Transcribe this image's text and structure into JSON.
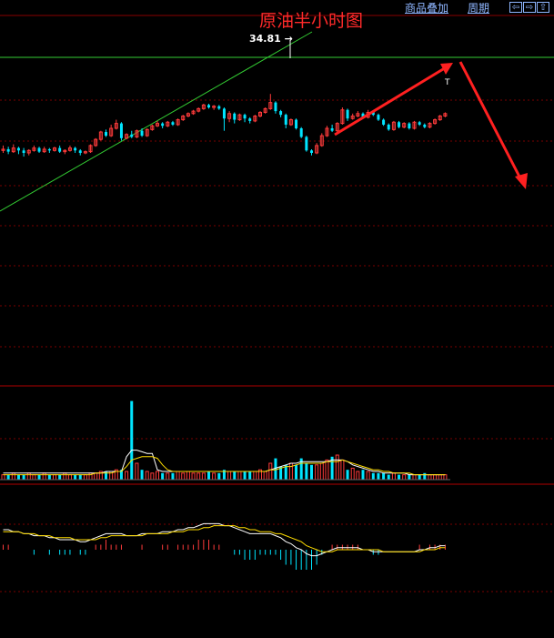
{
  "title": "原油半小时图",
  "toolbar": {
    "overlay_label": "商品叠加",
    "period_label": "周期",
    "nav_buttons": [
      {
        "icon": "arrow-left-icon",
        "glyph": "⇦"
      },
      {
        "icon": "arrow-right-icon",
        "glyph": "⇨"
      },
      {
        "icon": "arrow-up-icon",
        "glyph": "⇧"
      }
    ]
  },
  "colors": {
    "background": "#000000",
    "up_candle": "#ff3b3b",
    "down_candle": "#00e5ff",
    "grid": "#7a0000",
    "trendline": "#33cc33",
    "annotation_arrow": "#ff2020",
    "ma_white": "#ffffff",
    "ma_yellow": "#ffdd00",
    "title": "#ff2a2a",
    "toolbar_link": "#8fb6ff"
  },
  "chart_data": {
    "type": "candlestick",
    "title": "原油半小时图",
    "high_label": "34.81",
    "marker_label": "T",
    "price_scale": {
      "min": 0,
      "max": 100
    },
    "candles": [
      {
        "o": 62,
        "c": 63,
        "h": 66,
        "l": 60
      },
      {
        "o": 63,
        "c": 61,
        "h": 65,
        "l": 59
      },
      {
        "o": 61,
        "c": 64,
        "h": 67,
        "l": 60
      },
      {
        "o": 64,
        "c": 62,
        "h": 65,
        "l": 59
      },
      {
        "o": 62,
        "c": 60,
        "h": 64,
        "l": 57
      },
      {
        "o": 60,
        "c": 62,
        "h": 63,
        "l": 58
      },
      {
        "o": 62,
        "c": 64,
        "h": 66,
        "l": 61
      },
      {
        "o": 64,
        "c": 61,
        "h": 65,
        "l": 60
      },
      {
        "o": 61,
        "c": 63,
        "h": 65,
        "l": 60
      },
      {
        "o": 63,
        "c": 62,
        "h": 64,
        "l": 60
      },
      {
        "o": 62,
        "c": 64,
        "h": 65,
        "l": 61
      },
      {
        "o": 64,
        "c": 61,
        "h": 66,
        "l": 60
      },
      {
        "o": 61,
        "c": 62,
        "h": 63,
        "l": 59
      },
      {
        "o": 62,
        "c": 64,
        "h": 66,
        "l": 61
      },
      {
        "o": 64,
        "c": 62,
        "h": 65,
        "l": 60
      },
      {
        "o": 62,
        "c": 60,
        "h": 63,
        "l": 58
      },
      {
        "o": 60,
        "c": 61,
        "h": 62,
        "l": 59
      },
      {
        "o": 61,
        "c": 66,
        "h": 67,
        "l": 60
      },
      {
        "o": 66,
        "c": 71,
        "h": 72,
        "l": 65
      },
      {
        "o": 71,
        "c": 77,
        "h": 78,
        "l": 70
      },
      {
        "o": 77,
        "c": 74,
        "h": 79,
        "l": 73
      },
      {
        "o": 74,
        "c": 80,
        "h": 83,
        "l": 73
      },
      {
        "o": 80,
        "c": 84,
        "h": 87,
        "l": 79
      },
      {
        "o": 84,
        "c": 72,
        "h": 85,
        "l": 70
      },
      {
        "o": 72,
        "c": 75,
        "h": 76,
        "l": 71
      },
      {
        "o": 75,
        "c": 73,
        "h": 78,
        "l": 72
      },
      {
        "o": 73,
        "c": 78,
        "h": 79,
        "l": 72
      },
      {
        "o": 78,
        "c": 74,
        "h": 80,
        "l": 73
      },
      {
        "o": 74,
        "c": 79,
        "h": 80,
        "l": 73
      },
      {
        "o": 79,
        "c": 82,
        "h": 83,
        "l": 78
      },
      {
        "o": 82,
        "c": 84,
        "h": 86,
        "l": 81
      },
      {
        "o": 84,
        "c": 82,
        "h": 85,
        "l": 80
      },
      {
        "o": 82,
        "c": 85,
        "h": 86,
        "l": 81
      },
      {
        "o": 85,
        "c": 83,
        "h": 86,
        "l": 82
      },
      {
        "o": 83,
        "c": 87,
        "h": 88,
        "l": 82
      },
      {
        "o": 87,
        "c": 90,
        "h": 91,
        "l": 86
      },
      {
        "o": 90,
        "c": 92,
        "h": 93,
        "l": 89
      },
      {
        "o": 92,
        "c": 94,
        "h": 95,
        "l": 91
      },
      {
        "o": 94,
        "c": 96,
        "h": 97,
        "l": 93
      },
      {
        "o": 96,
        "c": 99,
        "h": 100,
        "l": 95
      },
      {
        "o": 99,
        "c": 97,
        "h": 100,
        "l": 96
      },
      {
        "o": 97,
        "c": 98,
        "h": 99,
        "l": 95
      },
      {
        "o": 98,
        "c": 96,
        "h": 99,
        "l": 95
      },
      {
        "o": 96,
        "c": 88,
        "h": 97,
        "l": 78
      },
      {
        "o": 88,
        "c": 92,
        "h": 94,
        "l": 85
      },
      {
        "o": 92,
        "c": 87,
        "h": 93,
        "l": 84
      },
      {
        "o": 87,
        "c": 91,
        "h": 92,
        "l": 86
      },
      {
        "o": 91,
        "c": 88,
        "h": 92,
        "l": 85
      },
      {
        "o": 88,
        "c": 86,
        "h": 89,
        "l": 84
      },
      {
        "o": 86,
        "c": 90,
        "h": 91,
        "l": 85
      },
      {
        "o": 90,
        "c": 93,
        "h": 94,
        "l": 89
      },
      {
        "o": 93,
        "c": 96,
        "h": 97,
        "l": 92
      },
      {
        "o": 96,
        "c": 101,
        "h": 108,
        "l": 95
      },
      {
        "o": 101,
        "c": 94,
        "h": 102,
        "l": 92
      },
      {
        "o": 94,
        "c": 91,
        "h": 95,
        "l": 89
      },
      {
        "o": 91,
        "c": 83,
        "h": 92,
        "l": 80
      },
      {
        "o": 83,
        "c": 87,
        "h": 88,
        "l": 82
      },
      {
        "o": 87,
        "c": 80,
        "h": 88,
        "l": 79
      },
      {
        "o": 80,
        "c": 73,
        "h": 81,
        "l": 72
      },
      {
        "o": 73,
        "c": 62,
        "h": 74,
        "l": 61
      },
      {
        "o": 62,
        "c": 60,
        "h": 63,
        "l": 58
      },
      {
        "o": 60,
        "c": 66,
        "h": 68,
        "l": 59
      },
      {
        "o": 66,
        "c": 74,
        "h": 76,
        "l": 65
      },
      {
        "o": 74,
        "c": 80,
        "h": 82,
        "l": 73
      },
      {
        "o": 80,
        "c": 78,
        "h": 83,
        "l": 77
      },
      {
        "o": 78,
        "c": 84,
        "h": 85,
        "l": 77
      },
      {
        "o": 84,
        "c": 95,
        "h": 97,
        "l": 83
      },
      {
        "o": 95,
        "c": 88,
        "h": 96,
        "l": 86
      },
      {
        "o": 88,
        "c": 90,
        "h": 92,
        "l": 87
      },
      {
        "o": 90,
        "c": 92,
        "h": 94,
        "l": 89
      },
      {
        "o": 92,
        "c": 89,
        "h": 93,
        "l": 88
      },
      {
        "o": 89,
        "c": 93,
        "h": 95,
        "l": 88
      },
      {
        "o": 93,
        "c": 91,
        "h": 94,
        "l": 90
      },
      {
        "o": 91,
        "c": 87,
        "h": 92,
        "l": 86
      },
      {
        "o": 87,
        "c": 83,
        "h": 88,
        "l": 82
      },
      {
        "o": 83,
        "c": 79,
        "h": 84,
        "l": 78
      },
      {
        "o": 79,
        "c": 85,
        "h": 86,
        "l": 78
      },
      {
        "o": 85,
        "c": 81,
        "h": 86,
        "l": 80
      },
      {
        "o": 81,
        "c": 84,
        "h": 85,
        "l": 80
      },
      {
        "o": 84,
        "c": 80,
        "h": 85,
        "l": 79
      },
      {
        "o": 80,
        "c": 85,
        "h": 86,
        "l": 79
      },
      {
        "o": 85,
        "c": 83,
        "h": 86,
        "l": 82
      },
      {
        "o": 83,
        "c": 81,
        "h": 84,
        "l": 80
      },
      {
        "o": 81,
        "c": 84,
        "h": 85,
        "l": 80
      },
      {
        "o": 84,
        "c": 87,
        "h": 88,
        "l": 83
      },
      {
        "o": 87,
        "c": 90,
        "h": 91,
        "l": 86
      },
      {
        "o": 90,
        "c": 92,
        "h": 93,
        "l": 89
      }
    ],
    "volume": [
      3,
      3,
      4,
      3,
      3,
      4,
      3,
      3,
      4,
      3,
      3,
      3,
      4,
      3,
      3,
      3,
      3,
      4,
      4,
      5,
      5,
      5,
      6,
      6,
      5,
      48,
      10,
      6,
      5,
      4,
      5,
      4,
      4,
      4,
      5,
      4,
      5,
      4,
      4,
      4,
      5,
      4,
      4,
      6,
      5,
      5,
      5,
      5,
      5,
      5,
      6,
      5,
      10,
      13,
      8,
      9,
      10,
      9,
      13,
      10,
      9,
      9,
      10,
      12,
      14,
      15,
      12,
      6,
      7,
      5,
      6,
      5,
      4,
      4,
      4,
      3,
      4,
      3,
      3,
      3,
      3,
      3,
      4,
      3,
      3,
      3,
      3
    ],
    "volume_ma_white": [
      4,
      4,
      4,
      4,
      4,
      4,
      4,
      4,
      4,
      4,
      4,
      4,
      4,
      4,
      4,
      4,
      4,
      4,
      4,
      4,
      5,
      5,
      5,
      5,
      14,
      18,
      18,
      17,
      16,
      16,
      6,
      5,
      5,
      5,
      5,
      5,
      5,
      5,
      5,
      5,
      5,
      5,
      5,
      5,
      5,
      5,
      5,
      5,
      5,
      5,
      5,
      5,
      6,
      7,
      8,
      9,
      10,
      10,
      11,
      11,
      11,
      11,
      11,
      11,
      12,
      12,
      12,
      11,
      9,
      8,
      7,
      6,
      5,
      5,
      4,
      4,
      4,
      4,
      4,
      3,
      3,
      3,
      3,
      3,
      3,
      3,
      3
    ],
    "volume_ma_yellow": [
      3,
      3,
      3,
      3,
      3,
      3,
      3,
      3,
      3,
      3,
      3,
      3,
      3,
      3,
      3,
      3,
      3,
      3,
      4,
      4,
      4,
      4,
      5,
      5,
      8,
      12,
      13,
      14,
      14,
      14,
      13,
      9,
      6,
      5,
      5,
      5,
      5,
      5,
      5,
      5,
      5,
      5,
      5,
      5,
      5,
      5,
      5,
      5,
      5,
      5,
      5,
      5,
      6,
      6,
      7,
      8,
      8,
      9,
      10,
      10,
      10,
      10,
      10,
      11,
      11,
      11,
      12,
      11,
      10,
      9,
      8,
      7,
      6,
      6,
      5,
      5,
      4,
      4,
      4,
      4,
      3,
      3,
      3,
      3,
      3,
      3,
      3
    ],
    "macd_dif": [
      10,
      10,
      9,
      9,
      8,
      8,
      7,
      7,
      7,
      6,
      6,
      5,
      5,
      5,
      5,
      4,
      4,
      5,
      6,
      7,
      8,
      8,
      8,
      8,
      7,
      7,
      7,
      8,
      8,
      8,
      8,
      9,
      9,
      9,
      10,
      10,
      11,
      11,
      12,
      13,
      13,
      13,
      13,
      12,
      12,
      11,
      10,
      9,
      8,
      8,
      8,
      8,
      8,
      7,
      6,
      4,
      3,
      1,
      0,
      -2,
      -3,
      -3,
      -2,
      -1,
      0,
      1,
      1,
      1,
      1,
      1,
      0,
      0,
      -1,
      -1,
      -1,
      -1,
      -1,
      -1,
      -1,
      -1,
      -1,
      0,
      0,
      1,
      1,
      2,
      2
    ],
    "macd_dea": [
      9,
      9,
      9,
      9,
      8,
      8,
      8,
      7,
      7,
      7,
      6,
      6,
      6,
      6,
      5,
      5,
      5,
      5,
      5,
      6,
      6,
      7,
      7,
      7,
      7,
      7,
      7,
      7,
      8,
      8,
      8,
      8,
      8,
      9,
      9,
      9,
      10,
      10,
      10,
      11,
      11,
      12,
      12,
      12,
      12,
      12,
      11,
      11,
      10,
      10,
      9,
      9,
      9,
      8,
      8,
      7,
      6,
      5,
      4,
      2,
      1,
      0,
      -1,
      -1,
      -1,
      0,
      0,
      0,
      0,
      0,
      0,
      0,
      0,
      0,
      -1,
      -1,
      -1,
      -1,
      -1,
      -1,
      -1,
      -1,
      0,
      0,
      0,
      1,
      1
    ],
    "macd_hist": [
      1,
      1,
      0,
      0,
      0,
      0,
      -1,
      0,
      0,
      -1,
      0,
      -1,
      -1,
      -1,
      0,
      -1,
      -1,
      0,
      1,
      1,
      2,
      1,
      1,
      1,
      0,
      0,
      0,
      1,
      0,
      0,
      0,
      1,
      1,
      0,
      1,
      1,
      1,
      1,
      2,
      2,
      2,
      1,
      1,
      0,
      0,
      -1,
      -1,
      -2,
      -2,
      -2,
      -1,
      -1,
      -1,
      -1,
      -2,
      -3,
      -3,
      -4,
      -4,
      -4,
      -4,
      -3,
      -1,
      0,
      1,
      1,
      1,
      1,
      1,
      1,
      0,
      0,
      -1,
      -1,
      0,
      0,
      0,
      0,
      0,
      0,
      0,
      1,
      0,
      1,
      1,
      1,
      1
    ]
  }
}
